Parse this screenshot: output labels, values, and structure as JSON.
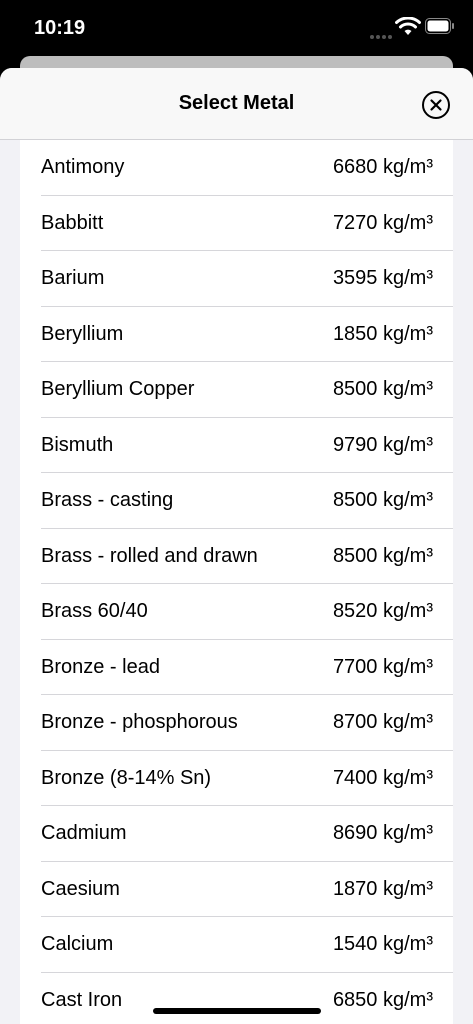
{
  "status_bar": {
    "time": "10:19"
  },
  "sheet": {
    "title": "Select Metal"
  },
  "metals": [
    {
      "name": "Antimony",
      "density": "6680 kg/m³"
    },
    {
      "name": "Babbitt",
      "density": "7270 kg/m³"
    },
    {
      "name": "Barium",
      "density": "3595 kg/m³"
    },
    {
      "name": "Beryllium",
      "density": "1850 kg/m³"
    },
    {
      "name": "Beryllium Copper",
      "density": "8500 kg/m³"
    },
    {
      "name": "Bismuth",
      "density": "9790 kg/m³"
    },
    {
      "name": "Brass - casting",
      "density": "8500 kg/m³"
    },
    {
      "name": "Brass - rolled and drawn",
      "density": "8500 kg/m³"
    },
    {
      "name": "Brass 60/40",
      "density": "8520 kg/m³"
    },
    {
      "name": "Bronze - lead",
      "density": "7700 kg/m³"
    },
    {
      "name": "Bronze - phosphorous",
      "density": "8700 kg/m³"
    },
    {
      "name": "Bronze (8-14% Sn)",
      "density": "7400 kg/m³"
    },
    {
      "name": "Cadmium",
      "density": "8690 kg/m³"
    },
    {
      "name": "Caesium",
      "density": "1870 kg/m³"
    },
    {
      "name": "Calcium",
      "density": "1540 kg/m³"
    },
    {
      "name": "Cast Iron",
      "density": "6850 kg/m³"
    }
  ],
  "icons": {
    "close": "close-circle-icon",
    "wifi": "wifi-icon",
    "battery": "battery-icon"
  }
}
